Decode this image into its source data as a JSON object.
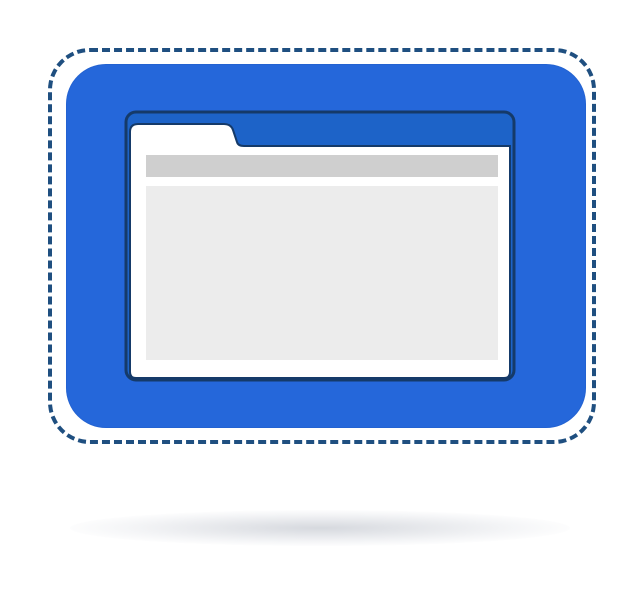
{
  "illustration": {
    "kind": "folder-window-icon",
    "icons": {
      "folder": "folder-icon",
      "window": "browser-window-icon",
      "selection": "dashed-selection-outline"
    },
    "colors": {
      "tile": "#2567da",
      "title_bar": "#1d63c8",
      "outline": "#1f4f80",
      "panel": "#ffffff",
      "address_bar": "#cfcfcf",
      "content": "#ececec",
      "shadow": "#d6d9df"
    }
  }
}
